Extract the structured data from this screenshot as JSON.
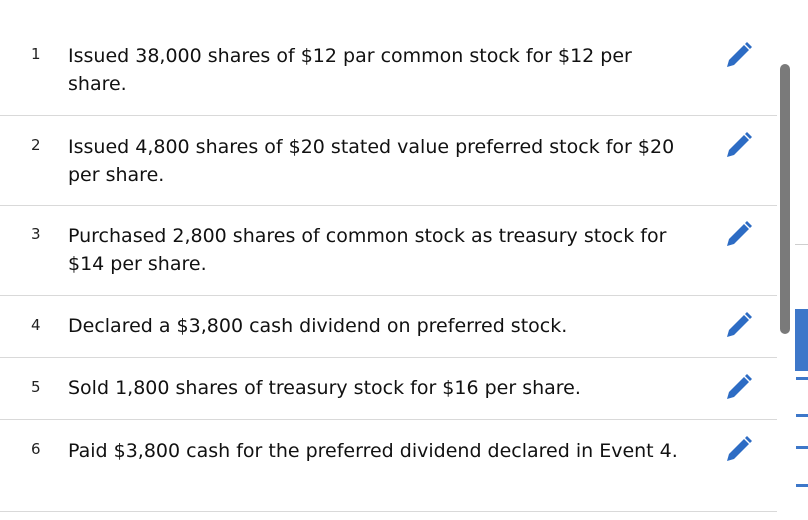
{
  "events": [
    {
      "number": "1",
      "description": "Issued 38,000 shares of $12 par common stock for $12 per share."
    },
    {
      "number": "2",
      "description": "Issued 4,800 shares of $20 stated value preferred stock for $20 per share."
    },
    {
      "number": "3",
      "description": "Purchased 2,800 shares of common stock as treasury stock for $14 per share."
    },
    {
      "number": "4",
      "description": "Declared a $3,800 cash dividend on preferred stock."
    },
    {
      "number": "5",
      "description": "Sold 1,800 shares of treasury stock for $16 per share."
    },
    {
      "number": "6",
      "description": "Paid $3,800 cash for the preferred dividend declared in Event 4."
    }
  ],
  "icons": {
    "edit": "pencil-icon"
  },
  "colors": {
    "pencil": "#2d6cc4",
    "accent": "#3d77c9",
    "scroll_thumb": "#7a7a7a"
  }
}
